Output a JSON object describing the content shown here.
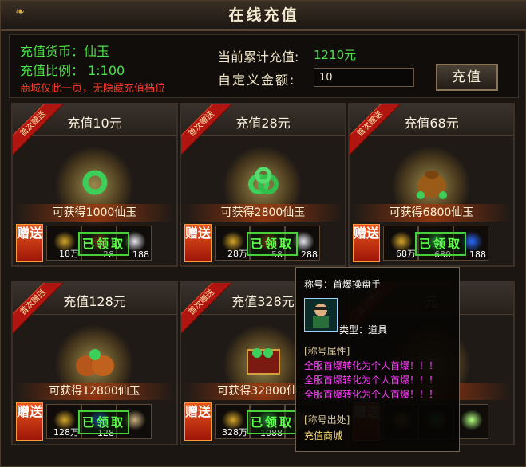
{
  "window": {
    "title": "在线充值"
  },
  "info": {
    "currency_label": "充值货币：仙玉",
    "ratio_label": "充值比例：  1:100",
    "notice": "商城仅此一页，无隐藏充值档位",
    "total_label": "当前累计充值:",
    "total_value": "1210元",
    "custom_label": "自定义金额:",
    "custom_value": "10",
    "recharge_button": "充值"
  },
  "ribbon_text": "首次赠送",
  "gift_label": "赠送",
  "claimed_label": "已领取",
  "packages": [
    {
      "price": "充值10元",
      "gain": "可获得1000仙玉",
      "slots": [
        "18万",
        "28",
        "188"
      ]
    },
    {
      "price": "充值28元",
      "gain": "可获得2800仙玉",
      "slots": [
        "28万",
        "58",
        "288"
      ]
    },
    {
      "price": "充值68元",
      "gain": "可获得6800仙玉",
      "slots": [
        "68万",
        "680",
        "188"
      ]
    },
    {
      "price": "充值128元",
      "gain": "可获得12800仙玉",
      "slots": [
        "128万",
        "128",
        ""
      ]
    },
    {
      "price": "充值328元",
      "gain": "可获得32800仙玉",
      "slots": [
        "328万",
        "1088",
        ""
      ]
    },
    {
      "price": "元",
      "gain": "玉",
      "slots": [
        "",
        "",
        ""
      ]
    }
  ],
  "tooltip": {
    "name": "称号：首爆操盘手",
    "type": "类型：道具",
    "attr_header": "[称号属性]",
    "attr_lines": [
      "全服首爆转化为个人首爆！！！",
      "全服首爆转化为个人首爆！！！",
      "全服首爆转化为个人首爆！！！"
    ],
    "source_header": "[称号出处]",
    "source": "充值商城"
  },
  "colors": {
    "accent_green": "#4ee04a",
    "notice_red": "#ff3a2a",
    "tooltip_magenta": "#ff3cff"
  }
}
